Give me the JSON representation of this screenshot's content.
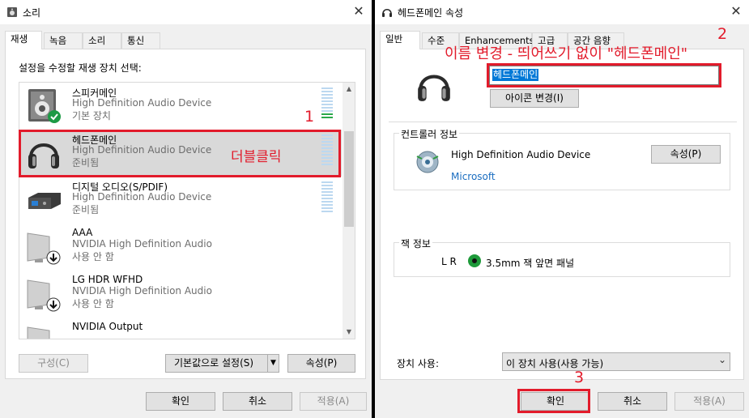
{
  "left_window": {
    "title": "소리",
    "close_glyph": "✕",
    "tabs": [
      "재생",
      "녹음",
      "소리",
      "통신"
    ],
    "instruction": "설정을 수정할 재생 장치 선택:",
    "devices": [
      {
        "name": "스피커메인",
        "desc": "High Definition Audio Device",
        "status": "기본 장치",
        "icon": "speaker-icon"
      },
      {
        "name": "헤드폰메인",
        "desc": "High Definition Audio Device",
        "status": "준비됨",
        "icon": "headphones-icon"
      },
      {
        "name": "디지털 오디오(S/PDIF)",
        "desc": "High Definition Audio Device",
        "status": "준비됨",
        "icon": "digital-audio-icon"
      },
      {
        "name": "AAA",
        "desc": "NVIDIA High Definition Audio",
        "status": "사용 안 함",
        "icon": "monitor-icon"
      },
      {
        "name": "LG HDR WFHD",
        "desc": "NVIDIA High Definition Audio",
        "status": "사용 안 함",
        "icon": "monitor-icon"
      },
      {
        "name": "NVIDIA Output",
        "desc": "",
        "status": "",
        "icon": "monitor-icon"
      }
    ],
    "buttons": {
      "configure": "구성(C)",
      "set_default": "기본값으로 설정(S)",
      "properties": "속성(P)",
      "ok": "확인",
      "cancel": "취소",
      "apply": "적용(A)"
    }
  },
  "right_window": {
    "title": "헤드폰메인 속성",
    "close_glyph": "✕",
    "tabs": [
      "일반",
      "수준",
      "Enhancements",
      "고급",
      "공간 음향"
    ],
    "name_value": "헤드폰메인",
    "change_icon_button": "아이콘 변경(I)",
    "controller_group": "컨트롤러 정보",
    "controller_name": "High Definition Audio Device",
    "controller_vendor": "Microsoft",
    "controller_properties_button": "속성(P)",
    "jack_group": "잭 정보",
    "jack_channels": "L R",
    "jack_desc": "3.5mm 잭 앞면 패널",
    "usage_label": "장치 사용:",
    "usage_value": "이 장치 사용(사용 가능)",
    "buttons": {
      "ok": "확인",
      "cancel": "취소",
      "apply": "적용(A)"
    }
  },
  "annotations": {
    "step1_number": "1",
    "step1_text": "더블클릭",
    "step2_number": "2",
    "step2_text": "이름 변경 - 띄어쓰기 없이 \"헤드폰메인\"",
    "step3_number": "3",
    "color": "#e21b2b"
  }
}
